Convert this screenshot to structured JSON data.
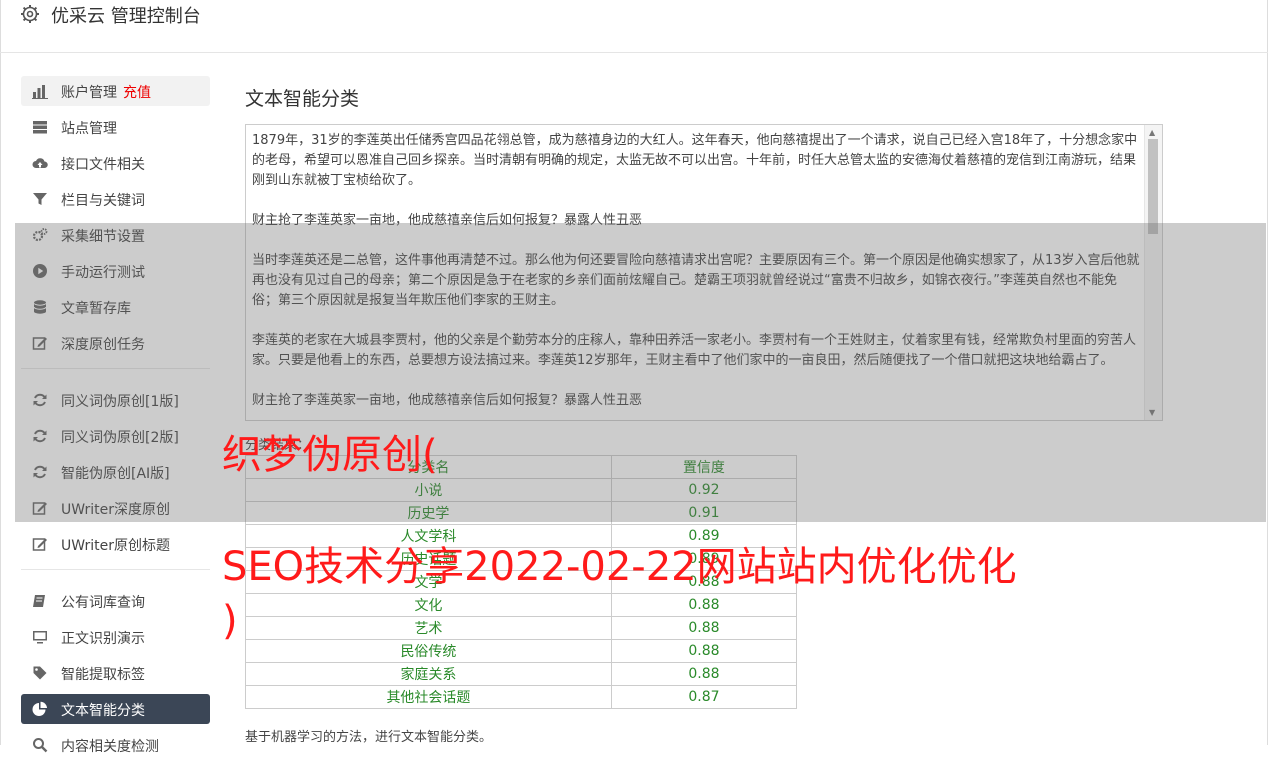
{
  "header": {
    "title": "优采云 管理控制台"
  },
  "sidebar": {
    "group1": [
      {
        "label": "账户管理",
        "badge": "充值",
        "icon": "bar-chart-icon"
      },
      {
        "label": "站点管理",
        "icon": "server-icon"
      },
      {
        "label": "接口文件相关",
        "icon": "cloud-upload-icon"
      },
      {
        "label": "栏目与关键词",
        "icon": "filter-icon"
      },
      {
        "label": "采集细节设置",
        "icon": "gears-icon"
      },
      {
        "label": "手动运行测试",
        "icon": "play-icon"
      },
      {
        "label": "文章暂存库",
        "icon": "database-icon"
      },
      {
        "label": "深度原创任务",
        "icon": "edit-icon"
      }
    ],
    "group2": [
      {
        "label": "同义词伪原创[1版]",
        "icon": "refresh-icon"
      },
      {
        "label": "同义词伪原创[2版]",
        "icon": "refresh-icon"
      },
      {
        "label": "智能伪原创[AI版]",
        "icon": "refresh-icon"
      },
      {
        "label": "UWriter深度原创",
        "icon": "edit-icon"
      },
      {
        "label": "UWriter原创标题",
        "icon": "edit-icon"
      }
    ],
    "group3": [
      {
        "label": "公有词库查询",
        "icon": "book-icon"
      },
      {
        "label": "正文识别演示",
        "icon": "monitor-icon"
      },
      {
        "label": "智能提取标签",
        "icon": "tag-icon"
      },
      {
        "label": "文本智能分类",
        "icon": "pie-chart-icon"
      },
      {
        "label": "内容相关度检测",
        "icon": "search-icon"
      }
    ]
  },
  "main": {
    "title": "文本智能分类",
    "text_paragraphs": [
      "1879年，31岁的李莲英出任储秀宫四品花翎总管，成为慈禧身边的大红人。这年春天，他向慈禧提出了一个请求，说自己已经入宫18年了，十分想念家中的老母，希望可以恩准自己回乡探亲。当时清朝有明确的规定，太监无故不可以出宫。十年前，时任大总管太监的安德海仗着慈禧的宠信到江南游玩，结果刚到山东就被丁宝桢给砍了。",
      "财主抢了李莲英家一亩地，他成慈禧亲信后如何报复？暴露人性丑恶",
      "当时李莲英还是二总管，这件事他再清楚不过。那么他为何还要冒险向慈禧请求出宫呢？主要原因有三个。第一个原因是他确实想家了，从13岁入宫后他就再也没有见过自己的母亲；第二个原因是急于在老家的乡亲们面前炫耀自己。楚霸王项羽就曾经说过“富贵不归故乡，如锦衣夜行。”李莲英自然也不能免俗；第三个原因就是报复当年欺压他们李家的王财主。",
      "李莲英的老家在大城县李贾村，他的父亲是个勤劳本分的庄稼人，靠种田养活一家老小。李贾村有一个王姓财主，仗着家里有钱，经常欺负村里面的穷苦人家。只要是他看上的东西，总要想方设法搞过来。李莲英12岁那年，王财主看中了他们家中的一亩良田，然后随便找了一个借口就把这块地给霸占了。",
      "财主抢了李莲英家一亩地，他成慈禧亲信后如何报复？暴露人性丑恶"
    ],
    "result_label": "分类结果：",
    "table": {
      "headers": [
        "分类名",
        "置信度"
      ],
      "rows": [
        [
          "小说",
          "0.92"
        ],
        [
          "历史学",
          "0.91"
        ],
        [
          "人文学科",
          "0.89"
        ],
        [
          "历史话题",
          "0.89"
        ],
        [
          "文学",
          "0.88"
        ],
        [
          "文化",
          "0.88"
        ],
        [
          "艺术",
          "0.88"
        ],
        [
          "民俗传统",
          "0.88"
        ],
        [
          "家庭关系",
          "0.88"
        ],
        [
          "其他社会话题",
          "0.87"
        ]
      ]
    },
    "footnote": "基于机器学习的方法，进行文本智能分类。"
  },
  "watermark": {
    "line1": "织梦伪原创(",
    "line2a": "SEO技术分享2022-02-22网站站内优化优化",
    "line2b": ")"
  }
}
